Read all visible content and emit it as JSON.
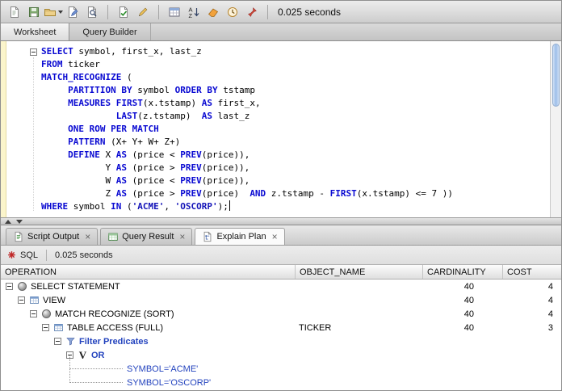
{
  "colors": {
    "keyword": "#0a0ad2",
    "string": "#1414b8",
    "predicate": "#2343be"
  },
  "toolbar": {
    "timing": "0.025 seconds",
    "items": [
      {
        "type": "icon",
        "name": "new-file-icon"
      },
      {
        "type": "icon",
        "name": "save-icon"
      },
      {
        "type": "icon",
        "name": "open-folder-icon",
        "dropdown": true
      },
      {
        "type": "icon",
        "name": "edit-document-icon"
      },
      {
        "type": "icon",
        "name": "search-document-icon"
      },
      {
        "type": "sep"
      },
      {
        "type": "icon",
        "name": "commit-icon"
      },
      {
        "type": "icon",
        "name": "pencil-icon"
      },
      {
        "type": "sep"
      },
      {
        "type": "icon",
        "name": "sql-worksheet-icon"
      },
      {
        "type": "icon",
        "name": "sort-az-icon"
      },
      {
        "type": "icon",
        "name": "eraser-icon"
      },
      {
        "type": "icon",
        "name": "history-icon"
      },
      {
        "type": "icon",
        "name": "pin-icon"
      },
      {
        "type": "sep"
      }
    ]
  },
  "tabs": [
    {
      "label": "Worksheet"
    },
    {
      "label": "Query Builder"
    }
  ],
  "editor": {
    "lines": [
      [
        {
          "t": "k",
          "x": "SELECT"
        },
        {
          "t": "p",
          "x": " symbol, first_x, last_z"
        }
      ],
      [
        {
          "t": "k",
          "x": "FROM"
        },
        {
          "t": "p",
          "x": " ticker"
        }
      ],
      [
        {
          "t": "k",
          "x": "MATCH_RECOGNIZE"
        },
        {
          "t": "p",
          "x": " ("
        }
      ],
      [
        {
          "t": "p",
          "x": "     "
        },
        {
          "t": "k",
          "x": "PARTITION BY"
        },
        {
          "t": "p",
          "x": " symbol "
        },
        {
          "t": "k",
          "x": "ORDER BY"
        },
        {
          "t": "p",
          "x": " tstamp"
        }
      ],
      [
        {
          "t": "p",
          "x": "     "
        },
        {
          "t": "k",
          "x": "MEASURES"
        },
        {
          "t": "p",
          "x": " "
        },
        {
          "t": "k",
          "x": "FIRST"
        },
        {
          "t": "p",
          "x": "(x.tstamp) "
        },
        {
          "t": "k",
          "x": "AS"
        },
        {
          "t": "p",
          "x": " first_x,"
        }
      ],
      [
        {
          "t": "p",
          "x": "              "
        },
        {
          "t": "k",
          "x": "LAST"
        },
        {
          "t": "p",
          "x": "(z.tstamp)  "
        },
        {
          "t": "k",
          "x": "AS"
        },
        {
          "t": "p",
          "x": " last_z"
        }
      ],
      [
        {
          "t": "p",
          "x": "     "
        },
        {
          "t": "k",
          "x": "ONE ROW PER MATCH"
        }
      ],
      [
        {
          "t": "p",
          "x": "     "
        },
        {
          "t": "k",
          "x": "PATTERN"
        },
        {
          "t": "p",
          "x": " (X+ Y+ W+ Z+)"
        }
      ],
      [
        {
          "t": "p",
          "x": "     "
        },
        {
          "t": "k",
          "x": "DEFINE"
        },
        {
          "t": "p",
          "x": " X "
        },
        {
          "t": "k",
          "x": "AS"
        },
        {
          "t": "p",
          "x": " (price < "
        },
        {
          "t": "k",
          "x": "PREV"
        },
        {
          "t": "p",
          "x": "(price)),"
        }
      ],
      [
        {
          "t": "p",
          "x": "            Y "
        },
        {
          "t": "k",
          "x": "AS"
        },
        {
          "t": "p",
          "x": " (price > "
        },
        {
          "t": "k",
          "x": "PREV"
        },
        {
          "t": "p",
          "x": "(price)),"
        }
      ],
      [
        {
          "t": "p",
          "x": "            W "
        },
        {
          "t": "k",
          "x": "AS"
        },
        {
          "t": "p",
          "x": " (price < "
        },
        {
          "t": "k",
          "x": "PREV"
        },
        {
          "t": "p",
          "x": "(price)),"
        }
      ],
      [
        {
          "t": "p",
          "x": "            Z "
        },
        {
          "t": "k",
          "x": "AS"
        },
        {
          "t": "p",
          "x": " (price > "
        },
        {
          "t": "k",
          "x": "PREV"
        },
        {
          "t": "p",
          "x": "(price)  "
        },
        {
          "t": "k",
          "x": "AND"
        },
        {
          "t": "p",
          "x": " z.tstamp - "
        },
        {
          "t": "k",
          "x": "FIRST"
        },
        {
          "t": "p",
          "x": "(x.tstamp) <= 7 ))"
        }
      ],
      [
        {
          "t": "k",
          "x": "WHERE"
        },
        {
          "t": "p",
          "x": " symbol "
        },
        {
          "t": "k",
          "x": "IN"
        },
        {
          "t": "p",
          "x": " ("
        },
        {
          "t": "s",
          "x": "'ACME'"
        },
        {
          "t": "p",
          "x": ", "
        },
        {
          "t": "s",
          "x": "'OSCORP'"
        },
        {
          "t": "p",
          "x": ");"
        }
      ]
    ]
  },
  "bottom_tabs": [
    {
      "id": "script-output",
      "label": "Script Output",
      "icon": "script-output-icon",
      "close": "×",
      "active": false
    },
    {
      "id": "query-result",
      "label": "Query Result",
      "icon": "query-result-icon",
      "close": "×",
      "active": false
    },
    {
      "id": "explain-plan",
      "label": "Explain Plan",
      "icon": "explain-plan-icon",
      "close": "×",
      "active": true
    }
  ],
  "plan": {
    "toolbar": {
      "sql_label": "SQL",
      "timing": "0.025 seconds"
    },
    "columns": [
      "OPERATION",
      "OBJECT_NAME",
      "CARDINALITY",
      "COST"
    ],
    "rows": [
      {
        "op": "SELECT STATEMENT",
        "obj": "",
        "card": "40",
        "cost": "4",
        "level": 0,
        "icon": "statement-icon",
        "expand": true,
        "style": "",
        "leaf": false
      },
      {
        "op": "VIEW",
        "obj": "",
        "card": "40",
        "cost": "4",
        "level": 1,
        "icon": "table-icon",
        "expand": true,
        "style": "",
        "leaf": false
      },
      {
        "op": "MATCH RECOGNIZE (SORT)",
        "obj": "",
        "card": "40",
        "cost": "4",
        "level": 2,
        "icon": "statement-icon",
        "expand": true,
        "style": "",
        "leaf": false
      },
      {
        "op": "TABLE ACCESS (FULL)",
        "obj": "TICKER",
        "card": "40",
        "cost": "3",
        "level": 3,
        "icon": "table-icon",
        "expand": true,
        "style": "",
        "leaf": false
      },
      {
        "op": "Filter Predicates",
        "obj": "",
        "card": "",
        "cost": "",
        "level": 4,
        "icon": "filter-icon",
        "expand": true,
        "style": "link-bold",
        "leaf": false
      },
      {
        "op": "OR",
        "obj": "",
        "card": "",
        "cost": "",
        "level": 5,
        "icon": "or-icon",
        "expand": true,
        "style": "link-bold",
        "leaf": false
      },
      {
        "op": "SYMBOL='ACME'",
        "obj": "",
        "card": "",
        "cost": "",
        "level": 10,
        "icon": "none",
        "expand": false,
        "style": "link",
        "leaf": true
      },
      {
        "op": "SYMBOL='OSCORP'",
        "obj": "",
        "card": "",
        "cost": "",
        "level": 10,
        "icon": "none",
        "expand": false,
        "style": "link",
        "leaf": true
      }
    ]
  }
}
